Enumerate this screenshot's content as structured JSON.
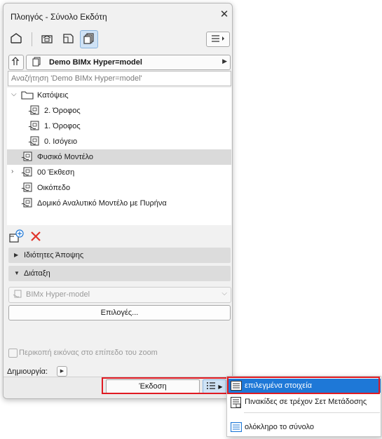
{
  "window": {
    "title": "Πλοηγός - Σύνολο Εκδότη",
    "close_icon": "close-icon"
  },
  "toolbar": {
    "buttons": [
      {
        "icon": "project-map-icon",
        "active": false
      },
      {
        "icon": "view-map-icon",
        "active": false
      },
      {
        "icon": "layout-book-icon",
        "active": false
      },
      {
        "icon": "publisher-sets-icon",
        "active": true
      }
    ],
    "menu_icon": "list-menu-icon"
  },
  "set_selector": {
    "value": "Demo BIMx Hyper=model"
  },
  "search": {
    "placeholder": "Αναζήτηση 'Demo BIMx Hyper=model'"
  },
  "tree": [
    {
      "label": "Κατόψεις",
      "type": "folder",
      "level": 0,
      "expanded": true,
      "selected": false
    },
    {
      "label": "2. Όροφος",
      "type": "view",
      "level": 1,
      "expanded": false,
      "selected": false
    },
    {
      "label": "1. Όροφος",
      "type": "view",
      "level": 1,
      "expanded": false,
      "selected": false
    },
    {
      "label": "0. Ισόγειο",
      "type": "view",
      "level": 1,
      "expanded": false,
      "selected": false
    },
    {
      "label": "Φυσικό Μοντέλο",
      "type": "view",
      "level": 0,
      "expanded": false,
      "selected": true
    },
    {
      "label": "00 Έκθεση",
      "type": "view",
      "level": 0,
      "collapsed_children": true,
      "selected": false
    },
    {
      "label": "Οικόπεδο",
      "type": "view",
      "level": 0,
      "expanded": false,
      "selected": false
    },
    {
      "label": "Δομικό Αναλυτικό Μοντέλο με Πυρήνα",
      "type": "view",
      "level": 0,
      "expanded": false,
      "selected": false
    }
  ],
  "actions": {
    "new_folder_icon": "new-folder-icon",
    "delete_icon": "delete-icon"
  },
  "sections": {
    "view_properties": "Ιδιότητες Άποψης",
    "layout": "Διάταξη"
  },
  "format_select": {
    "value": "BIMx Hyper-model"
  },
  "options_button": "Επιλογές...",
  "crop_checkbox": {
    "label": "Περικοπή εικόνας στο επίπεδο του zoom",
    "checked": false
  },
  "create": {
    "label": "Δημιουργία:"
  },
  "publish": {
    "button": "Έκδοση"
  },
  "popup_menu": [
    {
      "label": "επιλεγμένα στοιχεία",
      "highlighted": true
    },
    {
      "label": "Πινακίδες σε τρέχον Σετ Μετάδοσης",
      "highlighted": false
    },
    {
      "label": "ολόκληρο το σύνολο",
      "highlighted": false
    }
  ],
  "colors": {
    "accent": "#1e78d7",
    "highlight_box": "#e01a22",
    "selected_row": "#dadada"
  }
}
